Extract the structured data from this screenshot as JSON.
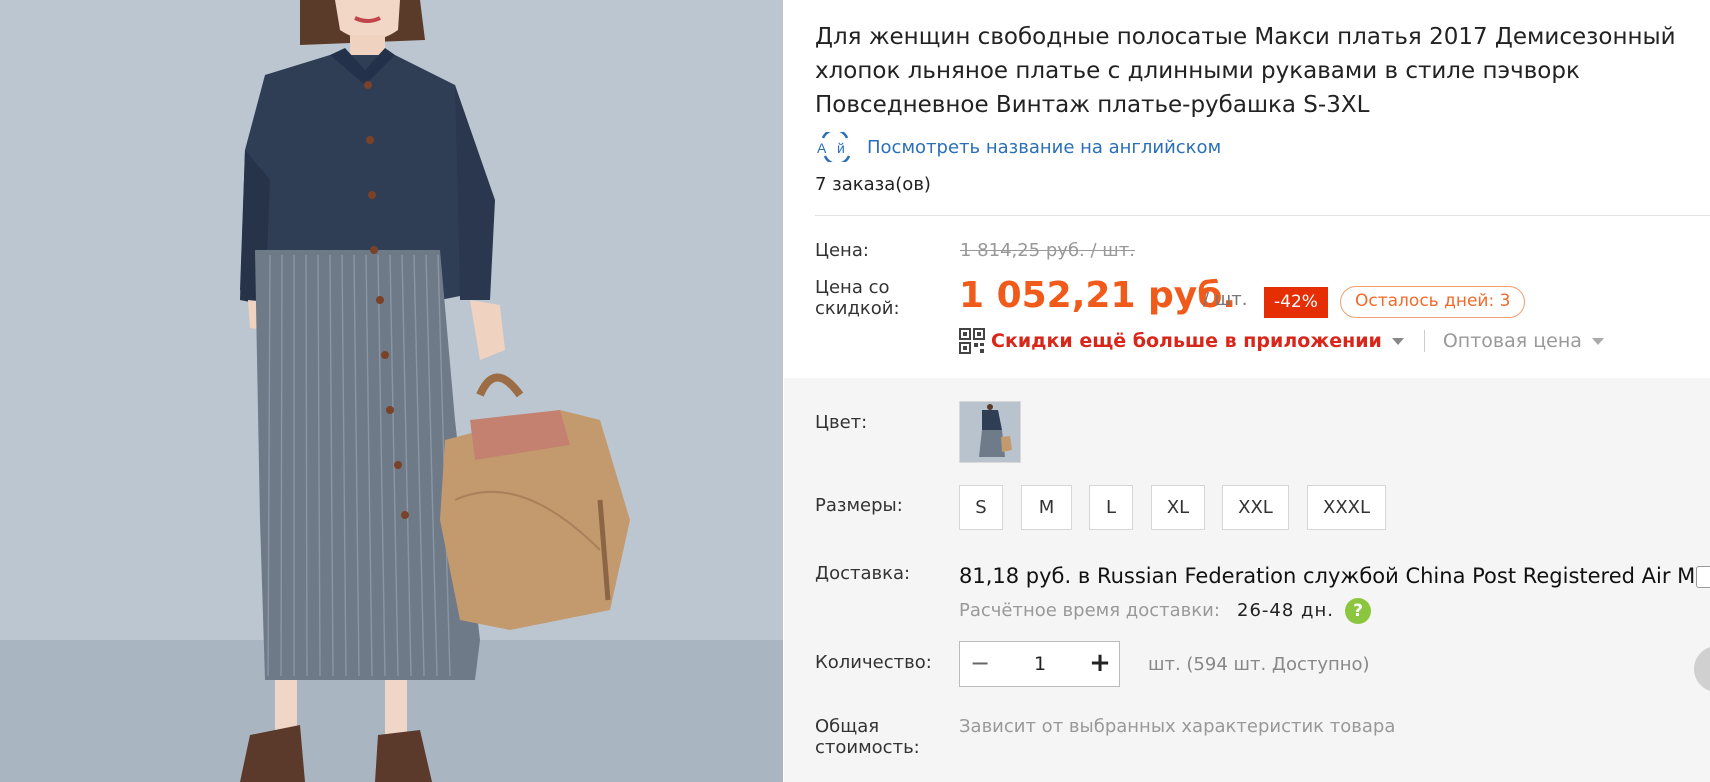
{
  "product": {
    "title": "Для женщин свободные полосатые Макси платья 2017 Демисезонный хлопок льняное платье с длинными рукавами в стиле пэчворк Повседневное Винтаж платье-рубашка S-3XL",
    "translate_link": "Посмотреть название на английском",
    "translate_icon_text": "А й",
    "orders": "7 заказа(ов)"
  },
  "price": {
    "price_label": "Цена:",
    "old_price": "1 814,25 руб. / шт.",
    "discount_label": "Цена со скидкой:",
    "new_price": "1 052,21 руб.",
    "per_unit": "/ шт.",
    "discount_badge": "-42%",
    "days_left": "Осталось дней: 3",
    "app_discount": "Скидки ещё больше в приложении",
    "wholesale": "Оптовая цена"
  },
  "options": {
    "color_label": "Цвет:",
    "sizes_label": "Размеры:",
    "sizes": [
      "S",
      "M",
      "L",
      "XL",
      "XXL",
      "XXXL"
    ]
  },
  "shipping": {
    "label": "Доставка:",
    "cost": "81,18 руб.",
    "to_word": "в",
    "destination": "Russian Federation",
    "service_word": "службой",
    "carrier": "China Post Registered Air Mail",
    "time_label": "Расчётное время доставки:",
    "time_value": "26-48 дн."
  },
  "quantity": {
    "label": "Количество:",
    "value": "1",
    "minus": "−",
    "plus": "+",
    "available": "шт. (594 шт. Доступно)"
  },
  "total": {
    "label": "Общая стоимость:",
    "value": "Зависит от выбранных характеристик товара"
  },
  "colors": {
    "accent_price": "#f05a1a",
    "badge": "#e62e04",
    "link": "#2a6fb8",
    "app_red": "#d8261a",
    "help_green": "#8cc63f"
  }
}
